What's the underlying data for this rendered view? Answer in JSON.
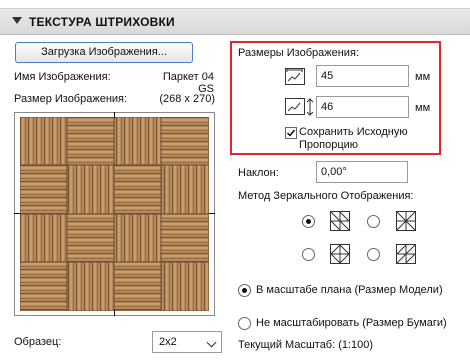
{
  "header": {
    "title": "ТЕКСТУРА ШТРИХОВКИ"
  },
  "load_button_label": "Загрузка Изображения...",
  "image_name_label": "Имя Изображения:",
  "image_name_value": "Паркет 04 GS",
  "image_size_label": "Размер Изображения:",
  "image_size_value": "(268 x 270)",
  "dimensions": {
    "title": "Размеры Изображения:",
    "width_value": "45",
    "height_value": "46",
    "unit": "мм",
    "keep_proportion_label_1": "Сохранить Исходную",
    "keep_proportion_label_2": "Пропорцию",
    "keep_proportion_checked": true
  },
  "tilt_label": "Наклон:",
  "tilt_value": "0,00°",
  "mirror_label": "Метод Зеркального Отображения:",
  "mirror_selected": 0,
  "scale_plan_label": "В масштабе плана (Размер Модели)",
  "no_scale_label": "Не масштабировать (Размер Бумаги)",
  "scale_selected": "plan",
  "current_scale_label": "Текущий Масштаб: (1:100)",
  "sample_label": "Образец:",
  "sample_value": "2x2",
  "colors": {
    "accent": "#e8232d",
    "button_border": "#4a7fd0",
    "wood_light": "#b98f61",
    "wood_dark": "#8a5f39"
  }
}
